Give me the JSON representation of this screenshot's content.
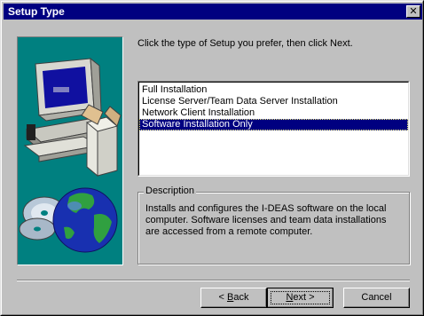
{
  "window": {
    "title": "Setup Type",
    "close_glyph": "✕",
    "icons": {
      "close": "close-icon"
    }
  },
  "main": {
    "prompt": "Click the type of Setup you prefer, then click Next.",
    "options": [
      {
        "label": "Full Installation",
        "selected": false
      },
      {
        "label": "License Server/Team Data Server Installation",
        "selected": false
      },
      {
        "label": "Network Client Installation",
        "selected": false
      },
      {
        "label": "Software Installation Only",
        "selected": true
      }
    ],
    "description": {
      "legend": "Description",
      "text": "Installs and configures the I-DEAS software on the local computer.  Software licenses and team data installations are accessed from a remote computer."
    }
  },
  "buttons": {
    "back_prefix": "< ",
    "back_accel": "B",
    "back_rest": "ack",
    "next_accel": "N",
    "next_rest": "ext >",
    "cancel": "Cancel"
  },
  "colors": {
    "titlebar": "#000080",
    "face": "#c0c0c0",
    "art_background": "#008080",
    "selection": "#000080"
  },
  "art": {
    "icons": [
      "computer-icon",
      "box-icon",
      "cd-icon",
      "globe-icon"
    ]
  }
}
